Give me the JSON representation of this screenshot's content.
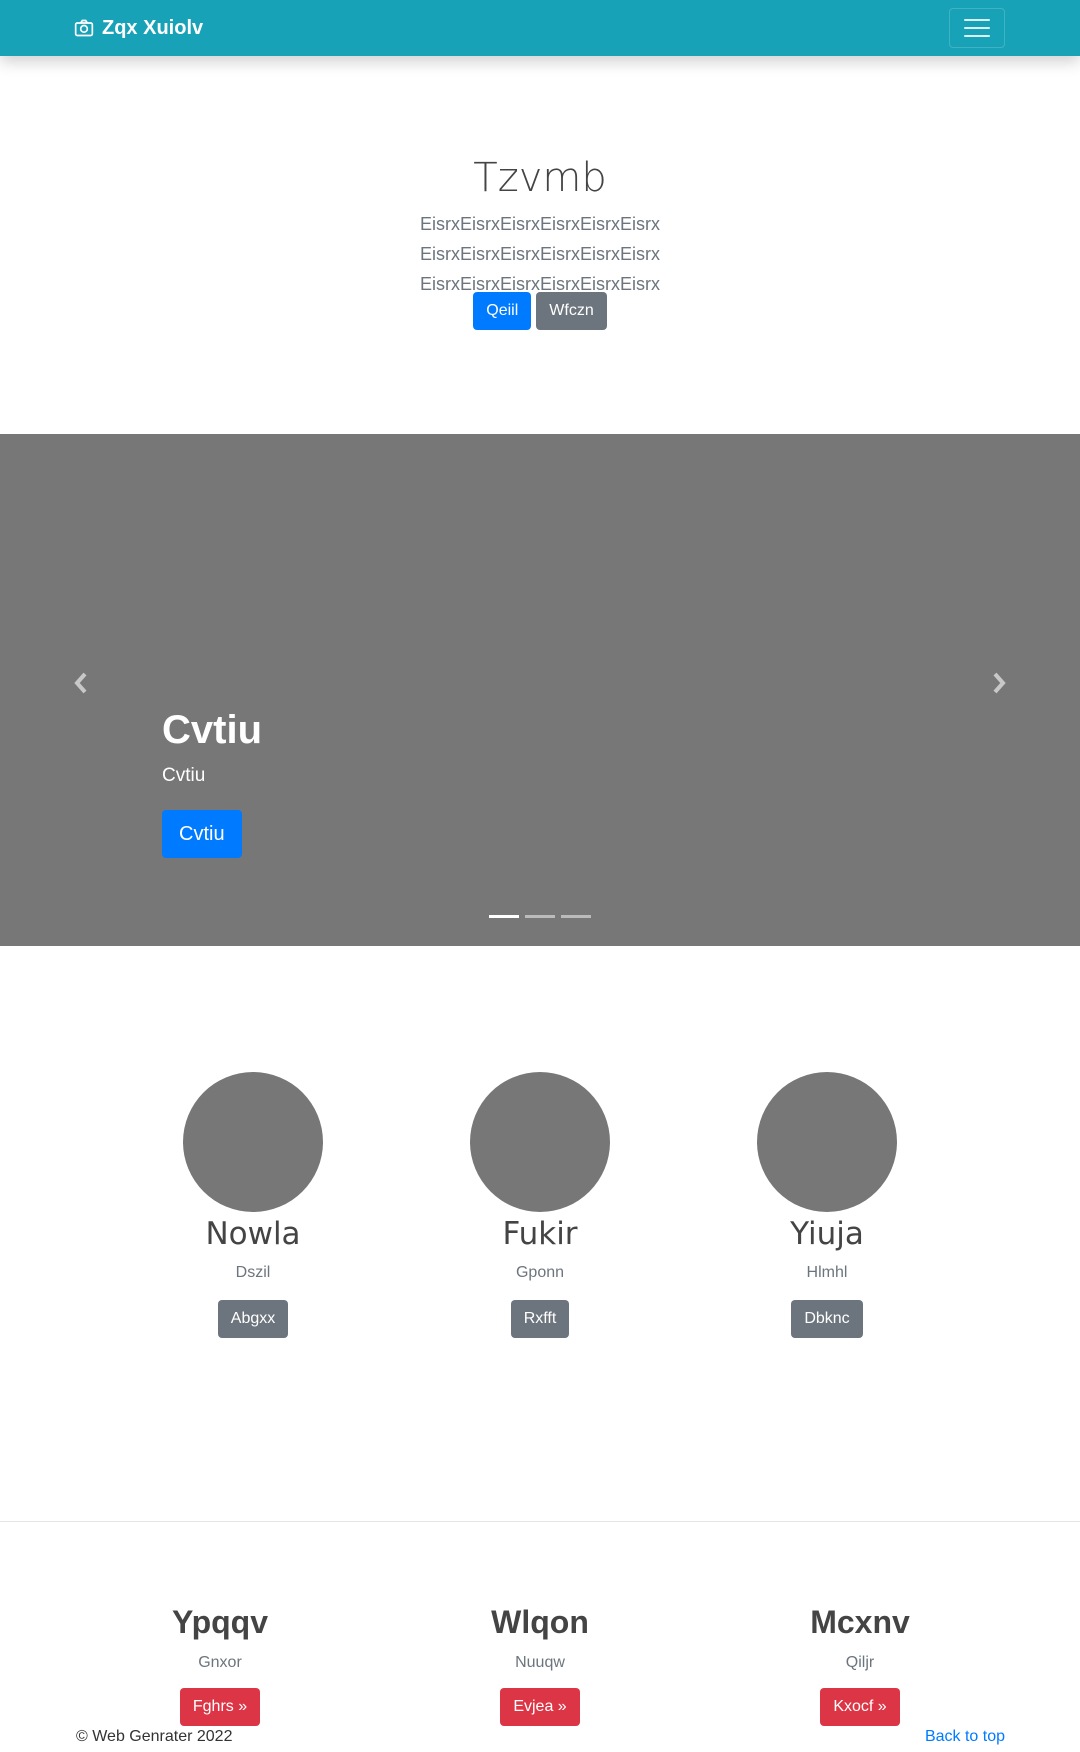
{
  "navbar": {
    "brand": "Zqx Xuiolv",
    "brand_icon": "camera-icon",
    "toggler_icon": "hamburger-menu-icon",
    "color": "#17a2b8"
  },
  "hero": {
    "title": "Tzvmb",
    "lead": "EisrxEisrxEisrxEisrxEisrxEisrx EisrxEisrxEisrxEisrxEisrxEisrx EisrxEisrxEisrxEisrxEisrxEisrx",
    "primary_button": "Qeiil",
    "secondary_button": "Wfczn"
  },
  "carousel": {
    "title": "Cvtiu",
    "subtitle": "Cvtiu",
    "button": "Cvtiu",
    "prev_icon": "chevron-left-icon",
    "next_icon": "chevron-right-icon",
    "slides": 3,
    "active_slide": 1,
    "background": "#777777"
  },
  "features": [
    {
      "title": "Nowla",
      "text": "Dszil",
      "button": "Abgxx"
    },
    {
      "title": "Fukir",
      "text": "Gponn",
      "button": "Rxfft"
    },
    {
      "title": "Yiuja",
      "text": "Hlmhl",
      "button": "Dbknc"
    }
  ],
  "bottom": [
    {
      "title": "Ypqqv",
      "text": "Gnxor",
      "button": "Fghrs »"
    },
    {
      "title": "Wlqon",
      "text": "Nuuqw",
      "button": "Evjea »"
    },
    {
      "title": "Mcxnv",
      "text": "Qiljr",
      "button": "Kxocf »"
    }
  ],
  "footer": {
    "copyright": "© Web Genrater 2022",
    "back_to_top": "Back to top"
  },
  "colors": {
    "primary": "#007bff",
    "secondary": "#6c757d",
    "danger": "#dc3545"
  }
}
